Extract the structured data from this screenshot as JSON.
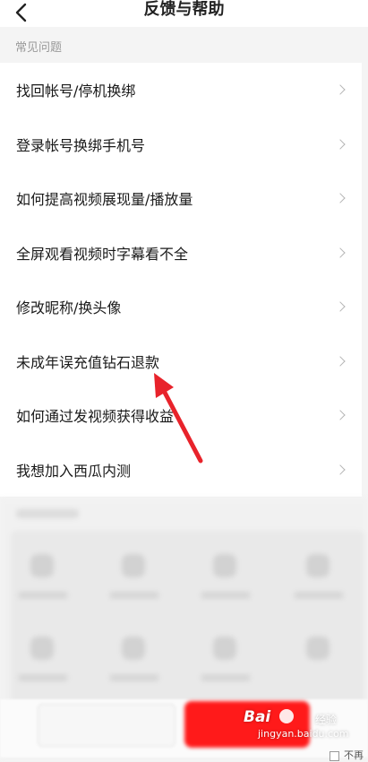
{
  "header": {
    "title": "反馈与帮助"
  },
  "section": {
    "label": "常见问题"
  },
  "faq": [
    {
      "label": "找回帐号/停机换绑"
    },
    {
      "label": "登录帐号换绑手机号"
    },
    {
      "label": "如何提高视频展现量/播放量"
    },
    {
      "label": "全屏观看视频时字幕看不全"
    },
    {
      "label": "修改昵称/换头像"
    },
    {
      "label": "未成年误充值钻石退款"
    },
    {
      "label": "如何通过发视频获得收益"
    },
    {
      "label": "我想加入西瓜内测"
    }
  ],
  "annotation": {
    "color": "#e8232b"
  },
  "watermark": {
    "brand": "Bai",
    "brand_cn": "经验",
    "url": "jingyan.baidu.com"
  },
  "corner": {
    "text": "不再"
  },
  "colors": {
    "primary": "#ff1a1a",
    "background": "#f4f4f4"
  }
}
